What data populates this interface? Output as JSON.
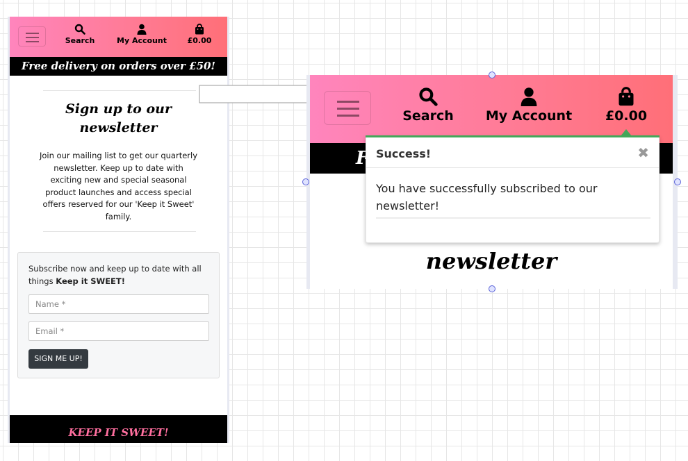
{
  "nav": {
    "search_label": "Search",
    "account_label": "My Account",
    "basket_total": "£0.00"
  },
  "promo_banner": "Free delivery on orders over £50!",
  "signup": {
    "title": "Sign up to our newsletter",
    "description": "Join our mailing list to get our quarterly newsletter. Keep up to date with exciting new and special seasonal product launches and access special offers reserved for our 'Keep it Sweet' family."
  },
  "form": {
    "intro": "Subscribe now and keep up to date with all things",
    "intro_bold": "Keep it SWEET!",
    "name_placeholder": "Name *",
    "email_placeholder": "Email *",
    "submit_label": "SIGN ME UP!"
  },
  "footer": {
    "tagline": "KEEP IT SWEET!"
  },
  "zoom": {
    "promo_fragment": "F",
    "title_fragment": "newsletter"
  },
  "toast": {
    "title": "Success!",
    "close_glyph": "✖",
    "message": "You have successfully subscribed to our newsletter!"
  },
  "colors": {
    "nav_gradient_start": "#ff85bd",
    "nav_gradient_end": "#ff6f78",
    "footer_accent": "#ff6f9f",
    "success_green": "#43a85a",
    "button_dark": "#343a40"
  },
  "icons": [
    "menu-icon",
    "search-icon",
    "user-icon",
    "shopping-bag-icon",
    "close-icon",
    "arrow-right-icon"
  ]
}
